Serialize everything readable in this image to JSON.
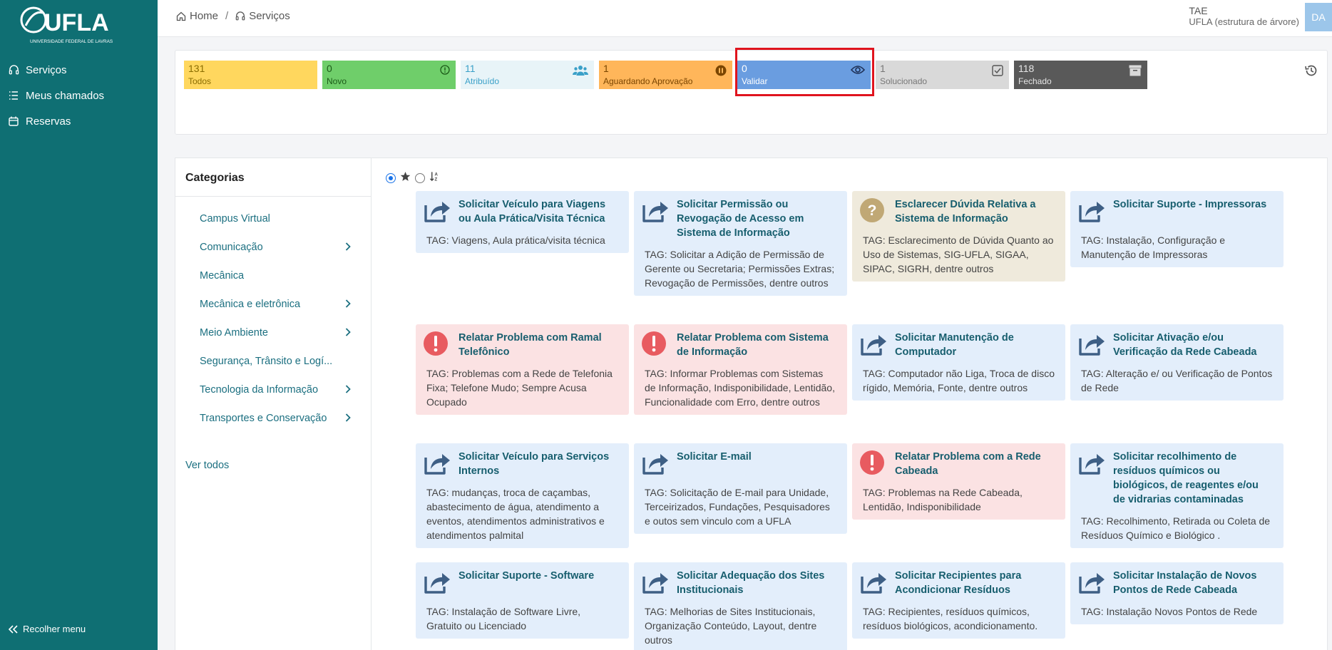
{
  "sidebar": {
    "logo_text": "UFLA",
    "logo_sub": "UNIVERSIDADE FEDERAL DE LAVRAS",
    "items": [
      {
        "label": "Serviços",
        "icon": "headset-icon"
      },
      {
        "label": "Meus chamados",
        "icon": "list-icon"
      },
      {
        "label": "Reservas",
        "icon": "calendar-icon"
      }
    ],
    "collapse_label": "Recolher menu"
  },
  "breadcrumb": {
    "home": "Home",
    "sep": "/",
    "current": "Serviços"
  },
  "user": {
    "role": "TAE",
    "entity": "UFLA (estrutura de árvore)",
    "initials": "DA"
  },
  "status_tiles": [
    {
      "count": "131",
      "label": "Todos",
      "bg": "#ffd75e",
      "fg": "#8a6d00",
      "icon": ""
    },
    {
      "count": "0",
      "label": "Novo",
      "bg": "#6fce6a",
      "fg": "#1c5a18",
      "icon": "alert-circle-icon"
    },
    {
      "count": "11",
      "label": "Atribuído",
      "bg": "#e8f4f8",
      "fg": "#3aa0c8",
      "icon": "users-icon"
    },
    {
      "count": "1",
      "label": "Aguardando Aprovação",
      "bg": "#ffb65a",
      "fg": "#7a4500",
      "icon": "pause-icon"
    },
    {
      "count": "0",
      "label": "Validar",
      "bg": "#6a9de0",
      "fg": "#ffffff",
      "icon": "eye-icon"
    },
    {
      "count": "1",
      "label": "Solucionado",
      "bg": "#d9d9d9",
      "fg": "#777777",
      "icon": "check-square-icon"
    },
    {
      "count": "118",
      "label": "Fechado",
      "bg": "#595959",
      "fg": "#e5e5e5",
      "icon": "archive-icon"
    }
  ],
  "categories": {
    "title": "Categorias",
    "items": [
      {
        "label": "Campus Virtual",
        "has_children": false
      },
      {
        "label": "Comunicação",
        "has_children": true
      },
      {
        "label": "Mecânica",
        "has_children": false
      },
      {
        "label": "Mecânica e eletrônica",
        "has_children": true
      },
      {
        "label": "Meio Ambiente",
        "has_children": true
      },
      {
        "label": "Segurança, Trânsito e Logí...",
        "has_children": false
      },
      {
        "label": "Tecnologia da Informação",
        "has_children": true
      },
      {
        "label": "Transportes e Conservação",
        "has_children": true
      }
    ],
    "see_all": "Ver todos"
  },
  "cards": [
    {
      "title": "Solicitar Veículo para Viagens ou Aula Prática/Visita Técnica",
      "tag": "TAG: Viagens, Aula prática/visita técnica",
      "variant": "blue",
      "icon": "share-arrow-icon"
    },
    {
      "title": "Solicitar Permissão ou Revogação de Acesso em Sistema de Informação",
      "tag": "TAG: Solicitar a Adição de Permissão de Gerente ou Secretaria; Permissões Extras; Revogação de Permissões, dentre outros",
      "variant": "blue",
      "icon": "share-arrow-icon"
    },
    {
      "title": "Esclarecer Dúvida Relativa a Sistema de Informação",
      "tag": "TAG: Esclarecimento de Dúvida Quanto ao Uso de Sistemas, SIG-UFLA, SIGAA, SIPAC, SIGRH, dentre outros",
      "variant": "beige",
      "icon": "question-icon"
    },
    {
      "title": "Solicitar Suporte - Impressoras",
      "tag": "TAG: Instalação, Configuração e Manutenção de Impressoras",
      "variant": "blue",
      "icon": "share-arrow-icon"
    },
    {
      "title": "Relatar Problema com Ramal Telefônico",
      "tag": "TAG: Problemas com a Rede de Telefonia Fixa; Telefone Mudo; Sempre Acusa Ocupado",
      "variant": "red",
      "icon": "exclamation-icon"
    },
    {
      "title": "Relatar Problema com Sistema de Informação",
      "tag": "TAG: Informar Problemas com Sistemas de Informação, Indisponibilidade, Lentidão, Funcionalidade com Erro, dentre outros",
      "variant": "red",
      "icon": "exclamation-icon"
    },
    {
      "title": "Solicitar Manutenção de Computador",
      "tag": "TAG: Computador não Liga, Troca de disco rígido, Memória, Fonte, dentre outros",
      "variant": "blue",
      "icon": "share-arrow-icon"
    },
    {
      "title": "Solicitar Ativação e/ou Verificação da Rede Cabeada",
      "tag": "TAG: Alteração e/ ou Verificação de Pontos de Rede",
      "variant": "blue",
      "icon": "share-arrow-icon"
    },
    {
      "title": "Solicitar Veículo para Serviços Internos",
      "tag": "TAG: mudanças, troca de caçambas, abastecimento de água, atendimento a eventos, atendimentos administrativos e atendimentos palmital",
      "variant": "blue",
      "icon": "share-arrow-icon"
    },
    {
      "title": "Solicitar E-mail",
      "tag": "TAG: Solicitação de E-mail para Unidade, Terceirizados, Fundações, Pesquisadores e outos sem vinculo com a UFLA",
      "variant": "blue",
      "icon": "share-arrow-icon"
    },
    {
      "title": "Relatar Problema com a Rede Cabeada",
      "tag": "TAG: Problemas na Rede Cabeada, Lentidão, Indisponibilidade",
      "variant": "red",
      "icon": "exclamation-icon"
    },
    {
      "title": "Solicitar recolhimento de resíduos químicos ou biológicos, de reagentes e/ou de vidrarias contaminadas",
      "tag": "TAG: Recolhimento, Retirada ou Coleta de Resíduos Químico e Biológico .",
      "variant": "blue",
      "icon": "share-arrow-icon"
    },
    {
      "title": "Solicitar Suporte - Software",
      "tag": "TAG: Instalação de Software Livre, Gratuito ou Licenciado",
      "variant": "blue",
      "icon": "share-arrow-icon"
    },
    {
      "title": "Solicitar Adequação dos Sites Institucionais",
      "tag": "TAG: Melhorias de Sites Institucionais, Organização Conteúdo, Layout, dentre outros",
      "variant": "blue",
      "icon": "share-arrow-icon"
    },
    {
      "title": "Solicitar Recipientes para Acondicionar Resíduos",
      "tag": "TAG: Recipientes, resíduos químicos, resíduos biológicos, acondicionamento.",
      "variant": "blue",
      "icon": "share-arrow-icon"
    },
    {
      "title": "Solicitar Instalação de Novos Pontos de Rede Cabeada",
      "tag": "TAG: Instalação Novos Pontos de Rede",
      "variant": "blue",
      "icon": "share-arrow-icon"
    }
  ]
}
